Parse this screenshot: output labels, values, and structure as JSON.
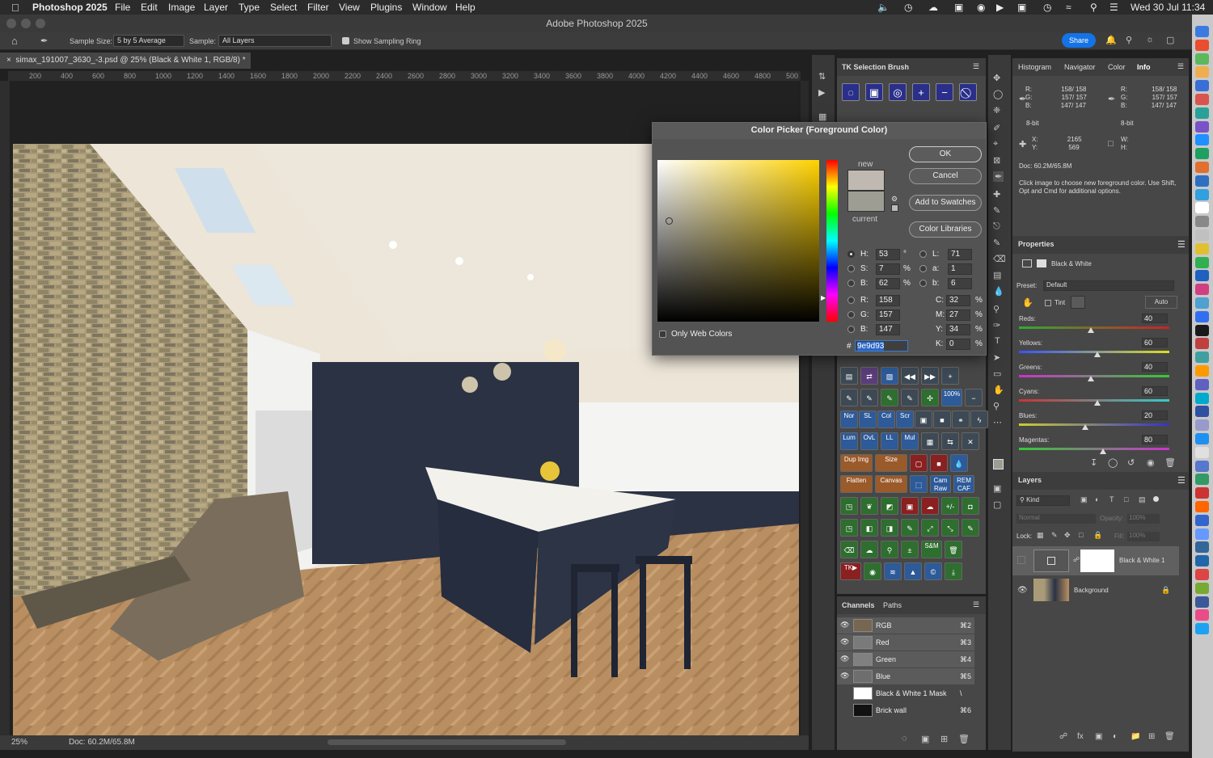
{
  "menubar": {
    "app": "Photoshop 2025",
    "items": [
      "File",
      "Edit",
      "Image",
      "Layer",
      "Type",
      "Select",
      "Filter",
      "View",
      "Plugins",
      "Window",
      "Help"
    ],
    "datetime": "Wed 30 Jul  11:34"
  },
  "window": {
    "title": "Adobe Photoshop 2025"
  },
  "options": {
    "sample_size_label": "Sample Size:",
    "sample_size": "5 by 5 Average",
    "sample_label": "Sample:",
    "sample": "All Layers",
    "show_ring": "Show Sampling Ring",
    "share": "Share"
  },
  "document": {
    "tab": "simax_191007_3630_-3.psd @ 25% (Black & White 1, RGB/8) *",
    "zoom": "25%",
    "doc_size": "Doc: 60.2M/65.8M"
  },
  "ruler": [
    "200",
    "400",
    "600",
    "800",
    "1000",
    "1200",
    "1400",
    "1600",
    "1800",
    "2000",
    "2200",
    "2400",
    "2600",
    "2800",
    "3000",
    "3200",
    "3400",
    "3600",
    "3800",
    "4000",
    "4200",
    "4400",
    "4600",
    "4800",
    "500"
  ],
  "color_picker": {
    "title": "Color Picker (Foreground Color)",
    "ok": "OK",
    "cancel": "Cancel",
    "add_swatches": "Add to Swatches",
    "libraries": "Color Libraries",
    "new_label": "new",
    "current_label": "current",
    "web_colors": "Only Web Colors",
    "new_color": "#bfb9b1",
    "current_color": "#9e9d93",
    "hue_color": "#ffd200",
    "hsb": [
      {
        "k": "H:",
        "v": "53",
        "u": "°"
      },
      {
        "k": "S:",
        "v": "7",
        "u": "%"
      },
      {
        "k": "B:",
        "v": "62",
        "u": "%"
      }
    ],
    "rgb": [
      {
        "k": "R:",
        "v": "158"
      },
      {
        "k": "G:",
        "v": "157"
      },
      {
        "k": "B:",
        "v": "147"
      }
    ],
    "lab": [
      {
        "k": "L:",
        "v": "71"
      },
      {
        "k": "a:",
        "v": "1"
      },
      {
        "k": "b:",
        "v": "6"
      }
    ],
    "cmyk": [
      {
        "k": "C:",
        "v": "32",
        "u": "%"
      },
      {
        "k": "M:",
        "v": "27",
        "u": "%"
      },
      {
        "k": "Y:",
        "v": "34",
        "u": "%"
      },
      {
        "k": "K:",
        "v": "0",
        "u": "%"
      }
    ],
    "hex_label": "#",
    "hex": "9e9d93"
  },
  "tk_panel": {
    "title": "TK Selection Brush",
    "labels": [
      "Nor",
      "SL",
      "Col",
      "Scr",
      "Lum",
      "OvL",
      "LL",
      "Mul",
      "Dup Img",
      "Size",
      "Flatten",
      "Canvas",
      "Cam Raw",
      "REM CAF",
      "100%",
      "S&M",
      "TK▶"
    ]
  },
  "channels": {
    "tabs": [
      "Channels",
      "Paths"
    ],
    "rows": [
      {
        "name": "RGB",
        "key": "⌘2"
      },
      {
        "name": "Red",
        "key": "⌘3"
      },
      {
        "name": "Green",
        "key": "⌘4"
      },
      {
        "name": "Blue",
        "key": "⌘5"
      },
      {
        "name": "Black & White 1 Mask",
        "key": "\\"
      },
      {
        "name": "Brick wall",
        "key": "⌘6"
      }
    ]
  },
  "info": {
    "tabs": [
      "Histogram",
      "Navigator",
      "Color",
      "Info"
    ],
    "left": {
      "R": "158/ 158",
      "G": "157/ 157",
      "B": "147/ 147",
      "bit": "8-bit",
      "X": "2165",
      "Y": "569"
    },
    "right": {
      "R": "158/ 158",
      "G": "157/ 157",
      "B": "147/ 147",
      "bit": "8-bit"
    },
    "doc": "Doc: 60.2M/65.8M",
    "hint": "Click image to choose new foreground color.  Use Shift, Opt and Cmd for additional options."
  },
  "properties": {
    "title": "Properties",
    "adjustment": "Black & White",
    "preset_label": "Preset:",
    "preset": "Default",
    "tint": "Tint",
    "auto": "Auto",
    "sliders": [
      {
        "name": "Reds:",
        "value": 40
      },
      {
        "name": "Yellows:",
        "value": 60
      },
      {
        "name": "Greens:",
        "value": 40
      },
      {
        "name": "Cyans:",
        "value": 60
      },
      {
        "name": "Blues:",
        "value": 20
      },
      {
        "name": "Magentas:",
        "value": 80
      }
    ]
  },
  "layers": {
    "title": "Layers",
    "kind": "Kind",
    "blend": "Normal",
    "opacity_label": "Opacity:",
    "opacity": "100%",
    "lock_label": "Lock:",
    "fill_label": "Fill:",
    "fill": "100%",
    "items": [
      {
        "name": "Black & White 1"
      },
      {
        "name": "Background"
      }
    ]
  }
}
